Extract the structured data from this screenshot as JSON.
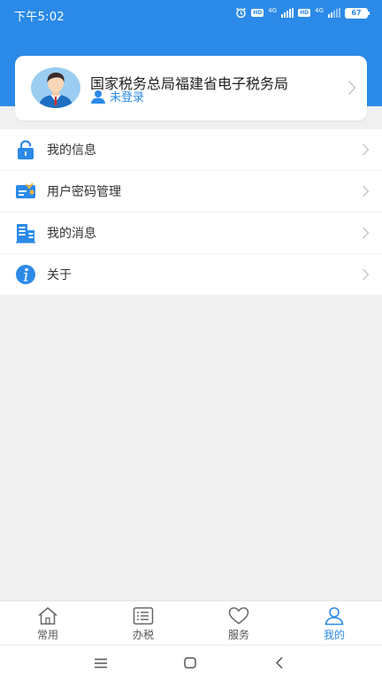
{
  "status_bar": {
    "time": "下午5:02",
    "hd1": "HD",
    "net1": "4G",
    "hd2": "HD",
    "net2": "4G",
    "battery": "67"
  },
  "profile": {
    "org_name": "国家税务总局福建省电子税务局",
    "login_status": "未登录"
  },
  "menu": {
    "items": [
      {
        "label": "我的信息",
        "icon": "lock-icon"
      },
      {
        "label": "用户密码管理",
        "icon": "key-card-icon"
      },
      {
        "label": "我的消息",
        "icon": "building-icon"
      },
      {
        "label": "关于",
        "icon": "info-icon"
      }
    ]
  },
  "tabs": [
    {
      "label": "常用",
      "icon": "home-icon"
    },
    {
      "label": "办税",
      "icon": "list-icon"
    },
    {
      "label": "服务",
      "icon": "heart-icon"
    },
    {
      "label": "我的",
      "icon": "user-icon"
    }
  ],
  "active_tab": "我的",
  "colors": {
    "accent": "#2b8ae8",
    "background": "#f0f0f0"
  }
}
